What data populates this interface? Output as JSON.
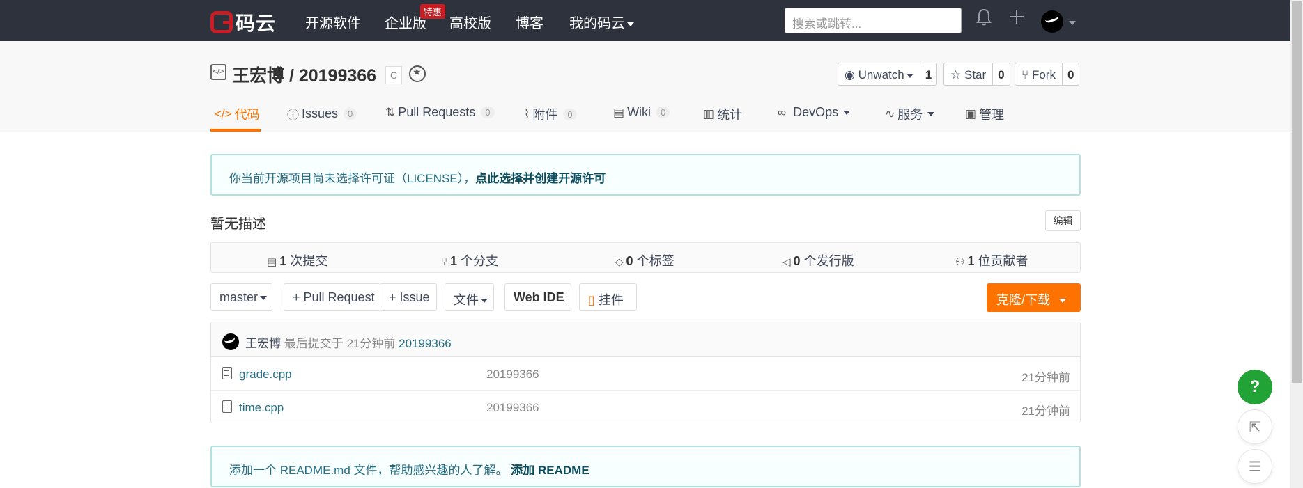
{
  "topbar": {
    "logo_text": "码云",
    "nav": [
      "开源软件",
      "企业版",
      "高校版",
      "博客",
      "我的码云"
    ],
    "hot_badge": "特惠",
    "search_placeholder": "搜索或跳转...",
    "icons": [
      "bell-icon",
      "plus-icon",
      "avatar"
    ]
  },
  "repo": {
    "owner_repo": "王宏博 / 20199366",
    "language_tag": "C",
    "watch": {
      "label": "Unwatch",
      "count": "1"
    },
    "star": {
      "label": "Star",
      "count": "0"
    },
    "fork": {
      "label": "Fork",
      "count": "0"
    }
  },
  "tabs": [
    {
      "label": "代码",
      "count": ""
    },
    {
      "label": "Issues",
      "count": "0"
    },
    {
      "label": "Pull Requests",
      "count": "0"
    },
    {
      "label": "附件",
      "count": "0"
    },
    {
      "label": "Wiki",
      "count": "0"
    },
    {
      "label": "统计",
      "count": ""
    },
    {
      "label": "DevOps",
      "count": ""
    },
    {
      "label": "服务",
      "count": ""
    },
    {
      "label": "管理",
      "count": ""
    }
  ],
  "license_notice": {
    "text": "你当前开源项目尚未选择许可证（LICENSE），",
    "link": "点此选择并创建开源许可"
  },
  "description": "暂无描述",
  "edit_label": "编辑",
  "stats": [
    {
      "num": "1",
      "label": "次提交"
    },
    {
      "num": "1",
      "label": "个分支"
    },
    {
      "num": "0",
      "label": "个标签"
    },
    {
      "num": "0",
      "label": "个发行版"
    },
    {
      "num": "1",
      "label": "位贡献者"
    }
  ],
  "controls": {
    "branch": "master",
    "pull_request": "+ Pull Request",
    "issue": "+ Issue",
    "file": "文件",
    "web_ide": "Web IDE",
    "widget": "挂件",
    "clone": "克隆/下载"
  },
  "last_commit": {
    "author": "王宏博",
    "meta": "最后提交于 21分钟前",
    "message": "20199366"
  },
  "files": [
    {
      "name": "grade.cpp",
      "message": "20199366",
      "time": "21分钟前"
    },
    {
      "name": "time.cpp",
      "message": "20199366",
      "time": "21分钟前"
    }
  ],
  "readme_notice": {
    "text": "添加一个 README.md 文件，帮助感兴趣的人了解。",
    "link": "添加 README"
  },
  "fab": {
    "help": "?"
  },
  "colors": {
    "accent": "#fe7300",
    "topbar": "#2e323d",
    "brand_red": "#c71d23",
    "link": "#276f86"
  }
}
